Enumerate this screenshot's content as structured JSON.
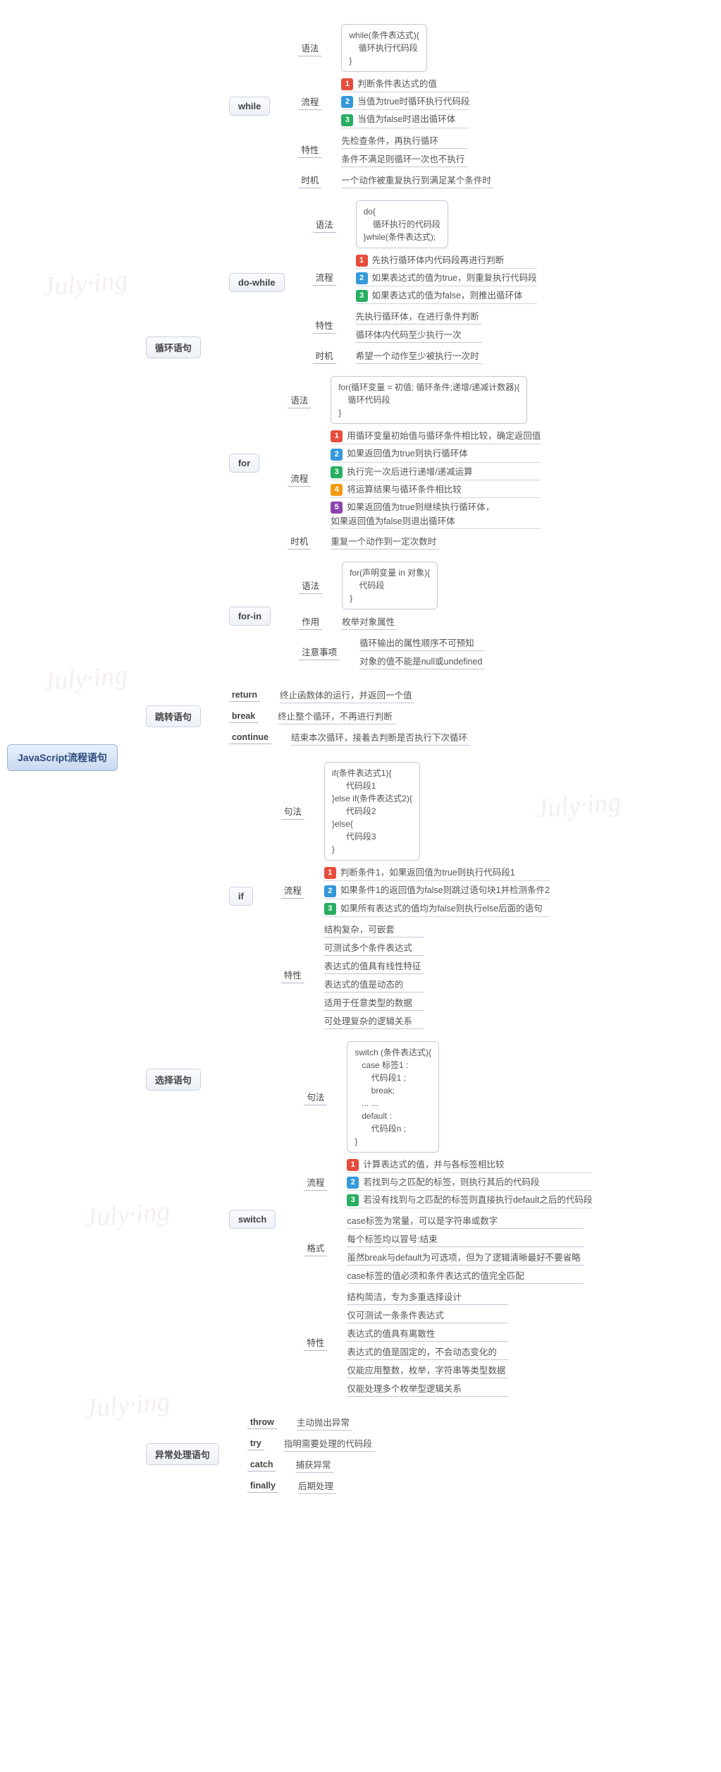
{
  "root": "JavaScript流程语句",
  "watermark": "July·ing",
  "branches": {
    "loop": {
      "label": "循环语句",
      "while": {
        "label": "while",
        "syntax_label": "语法",
        "syntax": "while(条件表达式){\n    循环执行代码段\n}",
        "flow_label": "流程",
        "flow": [
          "判断条件表达式的值",
          "当值为true时循环执行代码段",
          "当值为false时退出循环体"
        ],
        "trait_label": "特性",
        "trait": [
          "先检查条件，再执行循环",
          "条件不满足则循环一次也不执行"
        ],
        "timing_label": "时机",
        "timing": "一个动作被重复执行到满足某个条件时"
      },
      "dowhile": {
        "label": "do-while",
        "syntax_label": "语法",
        "syntax": "do{\n    循环执行的代码段\n}while(条件表达式);",
        "flow_label": "流程",
        "flow": [
          "先执行循环体内代码段再进行判断",
          "如果表达式的值为true，则重复执行代码段",
          "如果表达式的值为false，则推出循环体"
        ],
        "trait_label": "特性",
        "trait": [
          "先执行循环体，在进行条件判断",
          "循环体内代码至少执行一次"
        ],
        "timing_label": "时机",
        "timing": "希望一个动作至少被执行一次时"
      },
      "for": {
        "label": "for",
        "syntax_label": "语法",
        "syntax": "for(循环变量 = 初值; 循环条件;递增/递减计数器){\n    循环代码段\n}",
        "flow_label": "流程",
        "flow": [
          "用循环变量初始值与循环条件相比较，确定返回值",
          "如果返回值为true则执行循环体",
          "执行完一次后进行递增/递减运算",
          "将运算结果与循环条件相比较",
          "如果返回值为true则继续执行循环体，\n如果返回值为false则退出循环体"
        ],
        "timing_label": "时机",
        "timing": "重复一个动作到一定次数时"
      },
      "forin": {
        "label": "for-in",
        "syntax_label": "语法",
        "syntax": "for(声明变量 in 对象){\n    代码段\n}",
        "role_label": "作用",
        "role": "枚举对象属性",
        "note_label": "注意事项",
        "note": [
          "循环输出的属性顺序不可预知",
          "对象的值不能是null或undefined"
        ]
      }
    },
    "jump": {
      "label": "跳转语句",
      "return": {
        "label": "return",
        "desc": "终止函数体的运行，并返回一个值"
      },
      "break": {
        "label": "break",
        "desc": "终止整个循环，不再进行判断"
      },
      "continue": {
        "label": "continue",
        "desc": "结束本次循环，接着去判断是否执行下次循环"
      }
    },
    "select": {
      "label": "选择语句",
      "if": {
        "label": "if",
        "syntax_label": "句法",
        "syntax": "if(条件表达式1){\n      代码段1\n}else if(条件表达式2){\n      代码段2\n}else{\n      代码段3\n}",
        "flow_label": "流程",
        "flow": [
          "判断条件1，如果返回值为true则执行代码段1",
          "如果条件1的返回值为false则跳过语句块1并检测条件2",
          "如果所有表达式的值均为false则执行else后面的语句"
        ],
        "trait_label": "特性",
        "trait": [
          "结构复杂，可嵌套",
          "可测试多个条件表达式",
          "表达式的值具有线性特征",
          "表达式的值是动态的",
          "适用于任意类型的数据",
          "可处理复杂的逻辑关系"
        ]
      },
      "switch": {
        "label": "switch",
        "syntax_label": "句法",
        "syntax": "switch (条件表达式){\n   case 标签1 :\n       代码段1 ;\n       break;\n   ... ...\n   default :\n       代码段n ;\n}",
        "flow_label": "流程",
        "flow": [
          "计算表达式的值，并与各标签相比较",
          "若找到与之匹配的标签，则执行其后的代码段",
          "若没有找到与之匹配的标签则直接执行default之后的代码段"
        ],
        "format_label": "格式",
        "format": [
          "case标签为常量，可以是字符串或数字",
          "每个标签均以冒号:结束",
          "虽然break与default为可选项，但为了逻辑清晰最好不要省略",
          "case标签的值必须和条件表达式的值完全匹配"
        ],
        "trait_label": "特性",
        "trait": [
          "结构简洁，专为多重选择设计",
          "仅可测试一条条件表达式",
          "表达式的值具有离散性",
          "表达式的值是固定的，不会动态变化的",
          "仅能应用整数，枚举，字符串等类型数据",
          "仅能处理多个枚举型逻辑关系"
        ]
      }
    },
    "exception": {
      "label": "异常处理语句",
      "throw": {
        "label": "throw",
        "desc": "主动抛出异常"
      },
      "try": {
        "label": "try",
        "desc": "指明需要处理的代码段"
      },
      "catch": {
        "label": "catch",
        "desc": "捕获异常"
      },
      "finally": {
        "label": "finally",
        "desc": "后期处理"
      }
    }
  }
}
